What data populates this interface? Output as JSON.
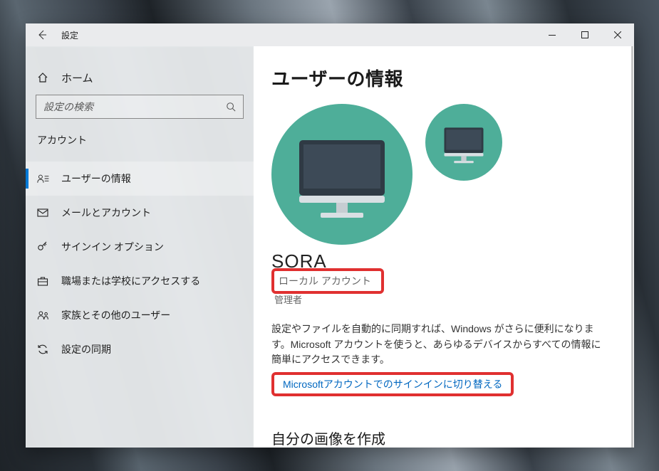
{
  "titlebar": {
    "title": "設定"
  },
  "home": {
    "label": "ホーム"
  },
  "search": {
    "placeholder": "設定の検索"
  },
  "section": {
    "label": "アカウント"
  },
  "nav": {
    "items": [
      {
        "label": "ユーザーの情報"
      },
      {
        "label": "メールとアカウント"
      },
      {
        "label": "サインイン オプション"
      },
      {
        "label": "職場または学校にアクセスする"
      },
      {
        "label": "家族とその他のユーザー"
      },
      {
        "label": "設定の同期"
      }
    ]
  },
  "page": {
    "title": "ユーザーの情報",
    "username": "SORA",
    "account_type": "ローカル アカウント",
    "role": "管理者",
    "description": "設定やファイルを自動的に同期すれば、Windows がさらに便利になります。Microsoft アカウントを使うと、あらゆるデバイスからすべての情報に簡単にアクセスできます。",
    "switch_link": "Microsoftアカウントでのサインインに切り替える",
    "sub_title": "自分の画像を作成"
  },
  "colors": {
    "accent": "#0078d4",
    "link": "#0067c0",
    "highlight": "#e03030",
    "avatar_bg": "#4eae99"
  }
}
